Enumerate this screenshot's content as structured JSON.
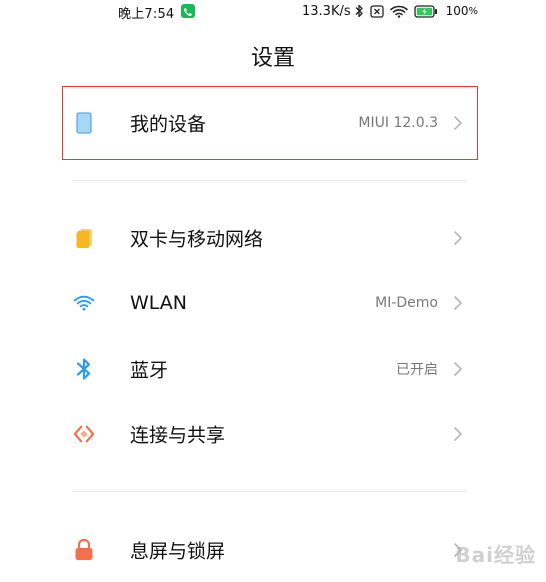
{
  "status_bar": {
    "time": "晚上7:54",
    "network_speed": "13.3K/s",
    "battery_percent": "100",
    "icons": [
      "phone-icon",
      "bluetooth-icon",
      "sim-disabled-icon",
      "wifi-icon",
      "battery-icon"
    ]
  },
  "page": {
    "title": "设置"
  },
  "rows": [
    {
      "label": "我的设备",
      "value": "MIUI 12.0.3",
      "icon": "device-icon",
      "highlighted": true
    },
    {
      "label": "双卡与移动网络",
      "value": "",
      "icon": "sim-icon"
    },
    {
      "label": "WLAN",
      "value": "MI-Demo",
      "icon": "wifi-icon"
    },
    {
      "label": "蓝牙",
      "value": "已开启",
      "icon": "bluetooth-icon"
    },
    {
      "label": "连接与共享",
      "value": "",
      "icon": "share-icon"
    },
    {
      "label": "息屏与锁屏",
      "value": "",
      "icon": "lock-icon"
    }
  ],
  "colors": {
    "highlight": "#e23b3b",
    "device": "#8ec8f5",
    "sim": "#f5b823",
    "wifi": "#2c9bf0",
    "bluetooth": "#2c9bf0",
    "share": "#f2704d",
    "lock": "#f2704d"
  },
  "watermark": "Bai经验"
}
